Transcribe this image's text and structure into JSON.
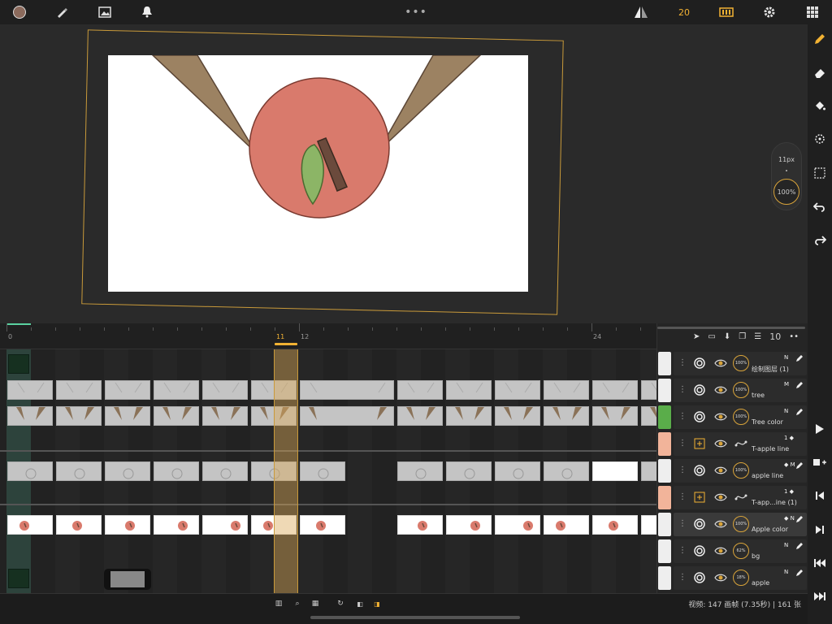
{
  "topbar": {
    "brush_color": "#8b6a5c",
    "more": "•••",
    "fps": "20",
    "icons": [
      "color-swatch",
      "brush-icon",
      "image-icon",
      "bell-icon",
      "flip-icon",
      "film-strip-icon",
      "gear-icon",
      "grid-icon"
    ]
  },
  "brush": {
    "size": "11px",
    "opacity": "100%"
  },
  "ruler": {
    "labels": [
      "0",
      "11",
      "12",
      "24"
    ],
    "current_frame": "11"
  },
  "layers": {
    "count": "10",
    "items": [
      {
        "name": "绘制图层 (1)",
        "blend": "N",
        "opacity": "100%",
        "swatch": "#eeeeee",
        "type": "paint"
      },
      {
        "name": "tree",
        "blend": "M",
        "opacity": "100%",
        "swatch": "#eeeeee",
        "type": "paint"
      },
      {
        "name": "Tree color",
        "blend": "N",
        "opacity": "100%",
        "swatch": "#5aad4a",
        "type": "paint"
      },
      {
        "name": "T-apple line",
        "blend": "1 ◆",
        "opacity": "",
        "swatch": "#f2b49a",
        "type": "transform"
      },
      {
        "name": "apple line",
        "blend": "◆ M",
        "opacity": "100%",
        "swatch": "#eeeeee",
        "type": "paint"
      },
      {
        "name": "T-app...ine (1)",
        "blend": "1 ◆",
        "opacity": "",
        "swatch": "#f2b49a",
        "type": "transform"
      },
      {
        "name": "Apple color",
        "blend": "◆ N",
        "opacity": "100%",
        "swatch": "#eeeeee",
        "type": "paint",
        "selected": true
      },
      {
        "name": "bg",
        "blend": "N",
        "opacity": "62%",
        "swatch": "#eeeeee",
        "type": "paint"
      },
      {
        "name": "apple",
        "blend": "N",
        "opacity": "18%",
        "swatch": "#eeeeee",
        "type": "paint"
      }
    ]
  },
  "status": "视频: 147 画帧 (7.35秒) | 161 张",
  "colors": {
    "accent": "#f2b233",
    "apple": "#d97a6c",
    "leaf": "#8cb566",
    "branch": "#9c8262",
    "stem": "#6b4a3c"
  }
}
